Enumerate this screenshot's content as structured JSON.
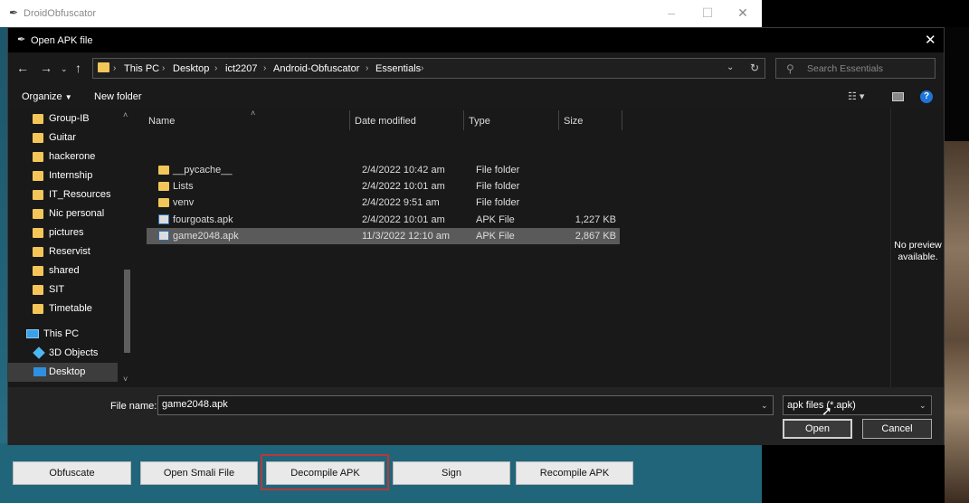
{
  "app": {
    "title": "DroidObfuscator",
    "buttons": [
      "Obfuscate",
      "Open Smali File",
      "Decompile APK",
      "Sign",
      "Recompile APK"
    ]
  },
  "dialog": {
    "title": "Open APK file",
    "breadcrumbs": [
      "This PC",
      "Desktop",
      "ict2207",
      "Android-Obfuscator",
      "Essentials"
    ],
    "search_placeholder": "Search Essentials",
    "toolbar": {
      "organize": "Organize",
      "new_folder": "New folder"
    },
    "columns": [
      "Name",
      "Date modified",
      "Type",
      "Size"
    ],
    "files": [
      {
        "name": "__pycache__",
        "date": "2/4/2022 10:42 am",
        "type": "File folder",
        "size": "",
        "kind": "folder"
      },
      {
        "name": "Lists",
        "date": "2/4/2022 10:01 am",
        "type": "File folder",
        "size": "",
        "kind": "folder"
      },
      {
        "name": "venv",
        "date": "2/4/2022 9:51 am",
        "type": "File folder",
        "size": "",
        "kind": "folder"
      },
      {
        "name": "fourgoats.apk",
        "date": "2/4/2022 10:01 am",
        "type": "APK File",
        "size": "1,227 KB",
        "kind": "file"
      },
      {
        "name": "game2048.apk",
        "date": "11/3/2022 12:10 am",
        "type": "APK File",
        "size": "2,867 KB",
        "kind": "file",
        "selected": true
      }
    ],
    "nav_items": [
      {
        "label": "Group-IB",
        "kind": "folder"
      },
      {
        "label": "Guitar",
        "kind": "folder"
      },
      {
        "label": "hackerone",
        "kind": "folder"
      },
      {
        "label": "Internship",
        "kind": "folder"
      },
      {
        "label": "IT_Resources",
        "kind": "folder"
      },
      {
        "label": "Nic personal",
        "kind": "folder"
      },
      {
        "label": "pictures",
        "kind": "folder"
      },
      {
        "label": "Reservist",
        "kind": "folder"
      },
      {
        "label": "shared",
        "kind": "folder"
      },
      {
        "label": "SIT",
        "kind": "folder"
      },
      {
        "label": "Timetable",
        "kind": "folder"
      }
    ],
    "nav_tree": [
      {
        "label": "This PC",
        "icon": "pc-icon"
      },
      {
        "label": "3D Objects",
        "icon": "cube-icon"
      },
      {
        "label": "Desktop",
        "icon": "desktop-icon",
        "selected": true
      }
    ],
    "preview_text": "No preview available.",
    "file_name_label": "File name:",
    "file_name_value": "game2048.apk",
    "filter": "apk files (*.apk)",
    "open_label": "Open",
    "cancel_label": "Cancel"
  },
  "colors": {
    "accent": "#1e74d8",
    "app_bg": "#1f5e73",
    "highlight": "#b63838",
    "folder": "#f4c65a"
  }
}
